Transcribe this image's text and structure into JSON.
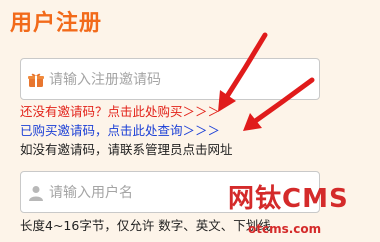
{
  "title": "用户注册",
  "invite_field": {
    "placeholder": "请输入注册邀请码",
    "icon": "gift-icon"
  },
  "buy_link": "还没有邀请码？点击此处购买＞＞＞",
  "query_link": "已购买邀请码，点击此处查询＞＞＞",
  "contact_note": "如没有邀请码，请联系管理员点击网址",
  "username_field": {
    "placeholder": "请输入用户名",
    "icon": "user-icon"
  },
  "username_hint": "长度4~16字节，仅允许 数字、英文、下划线",
  "watermark": {
    "title": "网钛CMS",
    "url": "otcms.com"
  },
  "colors": {
    "accent": "#f26a1a",
    "link_red": "#e2231a",
    "link_blue": "#1b3fd6",
    "arrow": "#e01b1b"
  }
}
